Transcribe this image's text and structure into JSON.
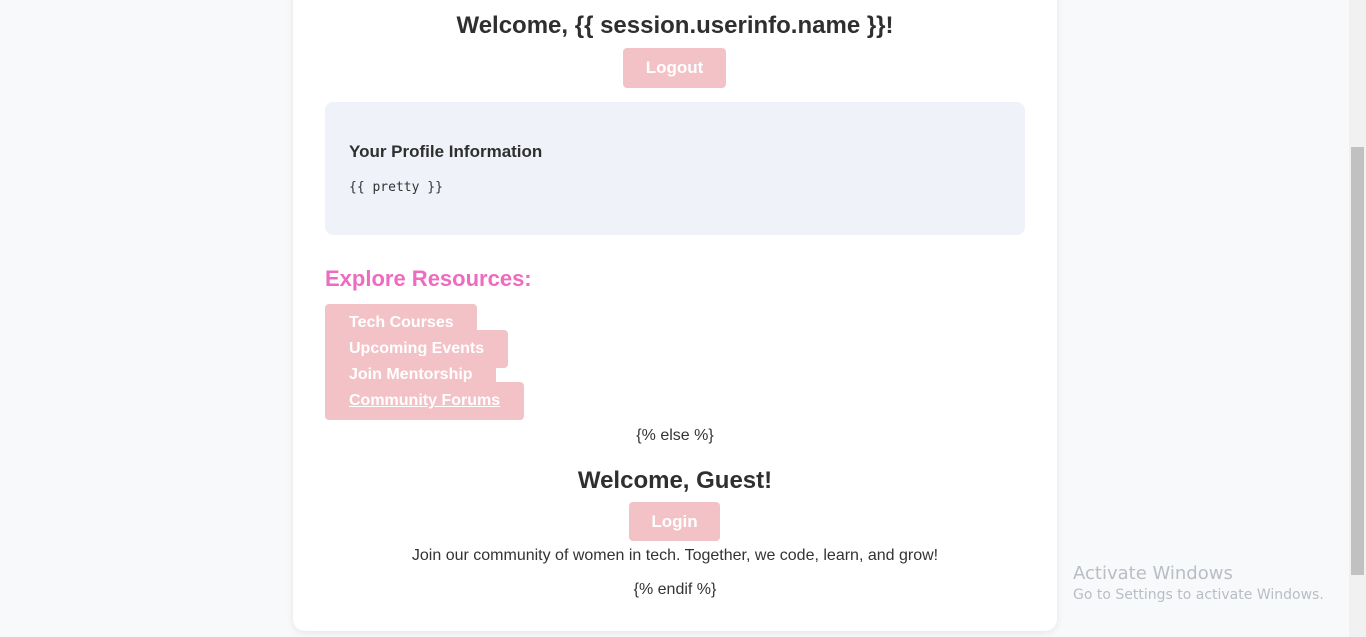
{
  "header": {
    "welcome_title": "Welcome, {{ session.userinfo.name }}!",
    "logout_label": "Logout"
  },
  "profile": {
    "heading": "Your Profile Information",
    "content": "{{ pretty }}"
  },
  "resources": {
    "heading": "Explore Resources:",
    "items": [
      {
        "label": "Tech Courses"
      },
      {
        "label": "Upcoming Events"
      },
      {
        "label": "Join Mentorship"
      },
      {
        "label": "Community Forums"
      }
    ]
  },
  "template": {
    "else_text": "{% else %}",
    "endif_text": "{% endif %}"
  },
  "guest": {
    "title": "Welcome, Guest!",
    "login_label": "Login",
    "tagline": "Join our community of women in tech. Together, we code, learn, and grow!"
  },
  "watermark": {
    "title": "Activate Windows",
    "subtitle": "Go to Settings to activate Windows."
  },
  "colors": {
    "accent_pink": "#ef6bbf",
    "button_pink": "#f2c2c6",
    "profile_bg": "#eff2f9"
  }
}
